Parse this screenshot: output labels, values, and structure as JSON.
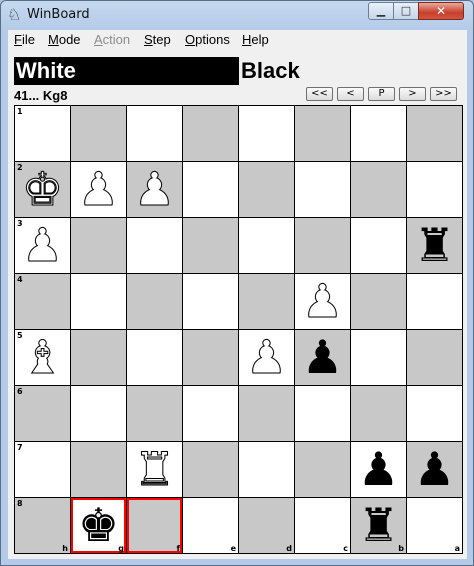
{
  "window": {
    "title": "WinBoard",
    "icon": "knight-icon"
  },
  "window_controls": {
    "minimize": "▁",
    "maximize": "□",
    "close": "✕"
  },
  "menu": [
    {
      "label": "File",
      "u": "F",
      "rest": "ile",
      "disabled": false
    },
    {
      "label": "Mode",
      "u": "M",
      "rest": "ode",
      "disabled": false
    },
    {
      "label": "Action",
      "u": "A",
      "rest": "ction",
      "disabled": true
    },
    {
      "label": "Step",
      "u": "S",
      "rest": "tep",
      "disabled": false
    },
    {
      "label": "Options",
      "u": "O",
      "rest": "ptions",
      "disabled": false
    },
    {
      "label": "Help",
      "u": "H",
      "rest": "elp",
      "disabled": false
    }
  ],
  "clocks": {
    "white": "White",
    "black": "Black"
  },
  "move_text": "41... Kg8",
  "nav_buttons": [
    "<<",
    "<",
    "P",
    ">",
    ">>"
  ],
  "colors": {
    "light_square": "#ffffff",
    "dark_square": "#c8c8c8",
    "highlight": "#ff0000"
  },
  "board": {
    "rank_labels": [
      "1",
      "2",
      "3",
      "4",
      "5",
      "6",
      "7",
      "8"
    ],
    "file_labels": [
      "h",
      "g",
      "f",
      "e",
      "d",
      "c",
      "b",
      "a"
    ],
    "pieces": [
      {
        "rank": 2,
        "col": 0,
        "glyph": "♚",
        "color": "white",
        "name": "white-king"
      },
      {
        "rank": 2,
        "col": 1,
        "glyph": "♟",
        "color": "white",
        "name": "white-pawn"
      },
      {
        "rank": 2,
        "col": 2,
        "glyph": "♟",
        "color": "white",
        "name": "white-pawn"
      },
      {
        "rank": 3,
        "col": 0,
        "glyph": "♟",
        "color": "white",
        "name": "white-pawn"
      },
      {
        "rank": 3,
        "col": 7,
        "glyph": "♜",
        "color": "black",
        "name": "black-rook"
      },
      {
        "rank": 4,
        "col": 5,
        "glyph": "♟",
        "color": "white",
        "name": "white-pawn"
      },
      {
        "rank": 5,
        "col": 0,
        "glyph": "♝",
        "color": "white",
        "name": "white-bishop"
      },
      {
        "rank": 5,
        "col": 4,
        "glyph": "♟",
        "color": "white",
        "name": "white-pawn"
      },
      {
        "rank": 5,
        "col": 5,
        "glyph": "♟",
        "color": "black",
        "name": "black-pawn"
      },
      {
        "rank": 7,
        "col": 2,
        "glyph": "♜",
        "color": "white",
        "name": "white-rook"
      },
      {
        "rank": 7,
        "col": 6,
        "glyph": "♟",
        "color": "black",
        "name": "black-pawn"
      },
      {
        "rank": 7,
        "col": 7,
        "glyph": "♟",
        "color": "black",
        "name": "black-pawn"
      },
      {
        "rank": 8,
        "col": 1,
        "glyph": "♚",
        "color": "black",
        "name": "black-king"
      },
      {
        "rank": 8,
        "col": 6,
        "glyph": "♜",
        "color": "black",
        "name": "black-rook"
      }
    ],
    "highlighted": [
      {
        "rank": 8,
        "col": 1
      },
      {
        "rank": 8,
        "col": 2
      }
    ]
  }
}
